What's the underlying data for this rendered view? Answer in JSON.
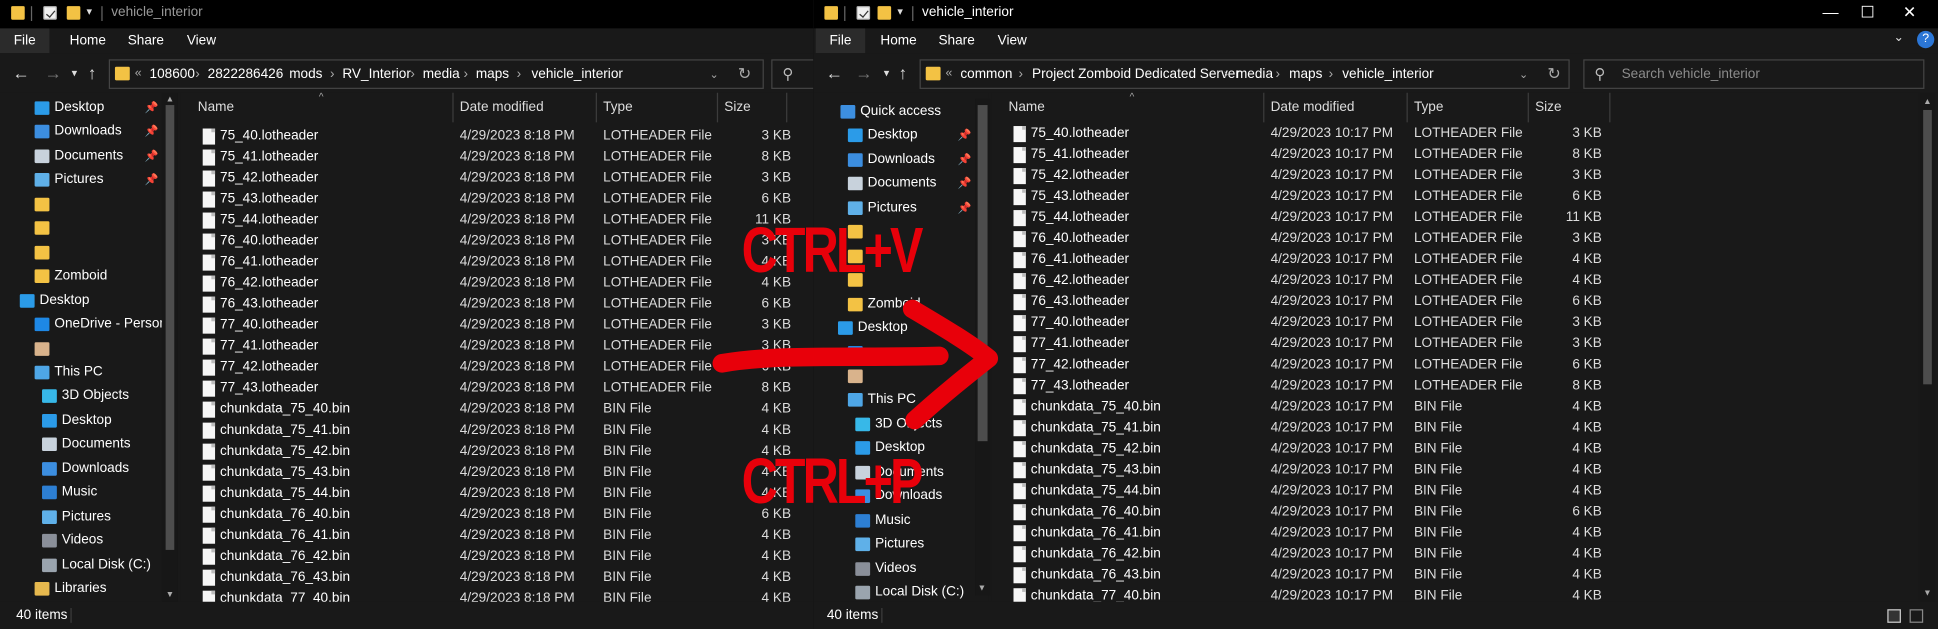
{
  "left_window": {
    "title": "vehicle_interior",
    "ribbon_tabs": [
      "File",
      "Home",
      "Share",
      "View"
    ],
    "address": {
      "overflow": "«",
      "crumbs": [
        "108600",
        "2822286426",
        "mods",
        "RV_Interior",
        "media",
        "maps",
        "vehicle_interior"
      ]
    },
    "nav_items": [
      {
        "label": "Desktop",
        "icon": "desktop-icon",
        "pinned": true
      },
      {
        "label": "Downloads",
        "icon": "downloads-icon",
        "pinned": true
      },
      {
        "label": "Documents",
        "icon": "documents-icon",
        "pinned": true
      },
      {
        "label": "Pictures",
        "icon": "pictures-icon",
        "pinned": true
      },
      {
        "label": "",
        "icon": "folder-icon",
        "pinned": false
      },
      {
        "label": "",
        "icon": "folder-icon",
        "pinned": false
      },
      {
        "label": "",
        "icon": "folder-icon",
        "pinned": false
      },
      {
        "label": "Zomboid",
        "icon": "folder-icon",
        "pinned": false
      },
      {
        "label": "Desktop",
        "icon": "desktop-icon",
        "pinned": false
      },
      {
        "label": "OneDrive - Personal",
        "icon": "cloud-icon",
        "pinned": false
      },
      {
        "label": "",
        "icon": "user-icon",
        "pinned": false
      },
      {
        "label": "This PC",
        "icon": "computer-icon",
        "pinned": false
      },
      {
        "label": "3D Objects",
        "icon": "3d-objects-icon",
        "pinned": false
      },
      {
        "label": "Desktop",
        "icon": "desktop-icon",
        "pinned": false
      },
      {
        "label": "Documents",
        "icon": "documents-icon",
        "pinned": false
      },
      {
        "label": "Downloads",
        "icon": "downloads-icon",
        "pinned": false
      },
      {
        "label": "Music",
        "icon": "music-icon",
        "pinned": false
      },
      {
        "label": "Pictures",
        "icon": "pictures-icon",
        "pinned": false
      },
      {
        "label": "Videos",
        "icon": "videos-icon",
        "pinned": false
      },
      {
        "label": "Local Disk (C:)",
        "icon": "drive-icon",
        "pinned": false
      },
      {
        "label": "Libraries",
        "icon": "libraries-icon",
        "pinned": false
      }
    ],
    "columns": [
      "Name",
      "Date modified",
      "Type",
      "Size"
    ],
    "files": [
      {
        "name": "75_40.lotheader",
        "date": "4/29/2023 8:18 PM",
        "type": "LOTHEADER File",
        "size": "3 KB"
      },
      {
        "name": "75_41.lotheader",
        "date": "4/29/2023 8:18 PM",
        "type": "LOTHEADER File",
        "size": "8 KB"
      },
      {
        "name": "75_42.lotheader",
        "date": "4/29/2023 8:18 PM",
        "type": "LOTHEADER File",
        "size": "3 KB"
      },
      {
        "name": "75_43.lotheader",
        "date": "4/29/2023 8:18 PM",
        "type": "LOTHEADER File",
        "size": "6 KB"
      },
      {
        "name": "75_44.lotheader",
        "date": "4/29/2023 8:18 PM",
        "type": "LOTHEADER File",
        "size": "11 KB"
      },
      {
        "name": "76_40.lotheader",
        "date": "4/29/2023 8:18 PM",
        "type": "LOTHEADER File",
        "size": "3 KB"
      },
      {
        "name": "76_41.lotheader",
        "date": "4/29/2023 8:18 PM",
        "type": "LOTHEADER File",
        "size": "4 KB"
      },
      {
        "name": "76_42.lotheader",
        "date": "4/29/2023 8:18 PM",
        "type": "LOTHEADER File",
        "size": "4 KB"
      },
      {
        "name": "76_43.lotheader",
        "date": "4/29/2023 8:18 PM",
        "type": "LOTHEADER File",
        "size": "6 KB"
      },
      {
        "name": "77_40.lotheader",
        "date": "4/29/2023 8:18 PM",
        "type": "LOTHEADER File",
        "size": "3 KB"
      },
      {
        "name": "77_41.lotheader",
        "date": "4/29/2023 8:18 PM",
        "type": "LOTHEADER File",
        "size": "3 KB"
      },
      {
        "name": "77_42.lotheader",
        "date": "4/29/2023 8:18 PM",
        "type": "LOTHEADER File",
        "size": "6 KB"
      },
      {
        "name": "77_43.lotheader",
        "date": "4/29/2023 8:18 PM",
        "type": "LOTHEADER File",
        "size": "8 KB"
      },
      {
        "name": "chunkdata_75_40.bin",
        "date": "4/29/2023 8:18 PM",
        "type": "BIN File",
        "size": "4 KB"
      },
      {
        "name": "chunkdata_75_41.bin",
        "date": "4/29/2023 8:18 PM",
        "type": "BIN File",
        "size": "4 KB"
      },
      {
        "name": "chunkdata_75_42.bin",
        "date": "4/29/2023 8:18 PM",
        "type": "BIN File",
        "size": "4 KB"
      },
      {
        "name": "chunkdata_75_43.bin",
        "date": "4/29/2023 8:18 PM",
        "type": "BIN File",
        "size": "4 KB"
      },
      {
        "name": "chunkdata_75_44.bin",
        "date": "4/29/2023 8:18 PM",
        "type": "BIN File",
        "size": "4 KB"
      },
      {
        "name": "chunkdata_76_40.bin",
        "date": "4/29/2023 8:18 PM",
        "type": "BIN File",
        "size": "6 KB"
      },
      {
        "name": "chunkdata_76_41.bin",
        "date": "4/29/2023 8:18 PM",
        "type": "BIN File",
        "size": "4 KB"
      },
      {
        "name": "chunkdata_76_42.bin",
        "date": "4/29/2023 8:18 PM",
        "type": "BIN File",
        "size": "4 KB"
      },
      {
        "name": "chunkdata_76_43.bin",
        "date": "4/29/2023 8:18 PM",
        "type": "BIN File",
        "size": "4 KB"
      },
      {
        "name": "chunkdata_77_40.bin",
        "date": "4/29/2023 8:18 PM",
        "type": "BIN File",
        "size": "4 KB"
      }
    ],
    "status": "40 items"
  },
  "right_window": {
    "title": "vehicle_interior",
    "ribbon_tabs": [
      "File",
      "Home",
      "Share",
      "View"
    ],
    "address": {
      "overflow": "«",
      "crumbs": [
        "common",
        "Project Zomboid Dedicated Server",
        "media",
        "maps",
        "vehicle_interior"
      ]
    },
    "search_placeholder": "Search vehicle_interior",
    "nav_items": [
      {
        "label": "Quick access",
        "icon": "star-icon",
        "pinned": false
      },
      {
        "label": "Desktop",
        "icon": "desktop-icon",
        "pinned": true
      },
      {
        "label": "Downloads",
        "icon": "downloads-icon",
        "pinned": true
      },
      {
        "label": "Documents",
        "icon": "documents-icon",
        "pinned": true
      },
      {
        "label": "Pictures",
        "icon": "pictures-icon",
        "pinned": true
      },
      {
        "label": "",
        "icon": "folder-icon",
        "pinned": false
      },
      {
        "label": "",
        "icon": "folder-icon",
        "pinned": false
      },
      {
        "label": "",
        "icon": "folder-icon",
        "pinned": false
      },
      {
        "label": "Zomboid",
        "icon": "folder-icon",
        "pinned": false
      },
      {
        "label": "Desktop",
        "icon": "desktop-icon",
        "pinned": false
      },
      {
        "label": "",
        "icon": "cloud-icon",
        "pinned": false
      },
      {
        "label": "",
        "icon": "user-icon",
        "pinned": false
      },
      {
        "label": "This PC",
        "icon": "computer-icon",
        "pinned": false
      },
      {
        "label": "3D Objects",
        "icon": "3d-objects-icon",
        "pinned": false
      },
      {
        "label": "Desktop",
        "icon": "desktop-icon",
        "pinned": false
      },
      {
        "label": "Documents",
        "icon": "documents-icon",
        "pinned": false
      },
      {
        "label": "Downloads",
        "icon": "downloads-icon",
        "pinned": false
      },
      {
        "label": "Music",
        "icon": "music-icon",
        "pinned": false
      },
      {
        "label": "Pictures",
        "icon": "pictures-icon",
        "pinned": false
      },
      {
        "label": "Videos",
        "icon": "videos-icon",
        "pinned": false
      },
      {
        "label": "Local Disk (C:)",
        "icon": "drive-icon",
        "pinned": false
      }
    ],
    "columns": [
      "Name",
      "Date modified",
      "Type",
      "Size"
    ],
    "files": [
      {
        "name": "75_40.lotheader",
        "date": "4/29/2023 10:17 PM",
        "type": "LOTHEADER File",
        "size": "3 KB"
      },
      {
        "name": "75_41.lotheader",
        "date": "4/29/2023 10:17 PM",
        "type": "LOTHEADER File",
        "size": "8 KB"
      },
      {
        "name": "75_42.lotheader",
        "date": "4/29/2023 10:17 PM",
        "type": "LOTHEADER File",
        "size": "3 KB"
      },
      {
        "name": "75_43.lotheader",
        "date": "4/29/2023 10:17 PM",
        "type": "LOTHEADER File",
        "size": "6 KB"
      },
      {
        "name": "75_44.lotheader",
        "date": "4/29/2023 10:17 PM",
        "type": "LOTHEADER File",
        "size": "11 KB"
      },
      {
        "name": "76_40.lotheader",
        "date": "4/29/2023 10:17 PM",
        "type": "LOTHEADER File",
        "size": "3 KB"
      },
      {
        "name": "76_41.lotheader",
        "date": "4/29/2023 10:17 PM",
        "type": "LOTHEADER File",
        "size": "4 KB"
      },
      {
        "name": "76_42.lotheader",
        "date": "4/29/2023 10:17 PM",
        "type": "LOTHEADER File",
        "size": "4 KB"
      },
      {
        "name": "76_43.lotheader",
        "date": "4/29/2023 10:17 PM",
        "type": "LOTHEADER File",
        "size": "6 KB"
      },
      {
        "name": "77_40.lotheader",
        "date": "4/29/2023 10:17 PM",
        "type": "LOTHEADER File",
        "size": "3 KB"
      },
      {
        "name": "77_41.lotheader",
        "date": "4/29/2023 10:17 PM",
        "type": "LOTHEADER File",
        "size": "3 KB"
      },
      {
        "name": "77_42.lotheader",
        "date": "4/29/2023 10:17 PM",
        "type": "LOTHEADER File",
        "size": "6 KB"
      },
      {
        "name": "77_43.lotheader",
        "date": "4/29/2023 10:17 PM",
        "type": "LOTHEADER File",
        "size": "8 KB"
      },
      {
        "name": "chunkdata_75_40.bin",
        "date": "4/29/2023 10:17 PM",
        "type": "BIN File",
        "size": "4 KB"
      },
      {
        "name": "chunkdata_75_41.bin",
        "date": "4/29/2023 10:17 PM",
        "type": "BIN File",
        "size": "4 KB"
      },
      {
        "name": "chunkdata_75_42.bin",
        "date": "4/29/2023 10:17 PM",
        "type": "BIN File",
        "size": "4 KB"
      },
      {
        "name": "chunkdata_75_43.bin",
        "date": "4/29/2023 10:17 PM",
        "type": "BIN File",
        "size": "4 KB"
      },
      {
        "name": "chunkdata_75_44.bin",
        "date": "4/29/2023 10:17 PM",
        "type": "BIN File",
        "size": "4 KB"
      },
      {
        "name": "chunkdata_76_40.bin",
        "date": "4/29/2023 10:17 PM",
        "type": "BIN File",
        "size": "6 KB"
      },
      {
        "name": "chunkdata_76_41.bin",
        "date": "4/29/2023 10:17 PM",
        "type": "BIN File",
        "size": "4 KB"
      },
      {
        "name": "chunkdata_76_42.bin",
        "date": "4/29/2023 10:17 PM",
        "type": "BIN File",
        "size": "4 KB"
      },
      {
        "name": "chunkdata_76_43.bin",
        "date": "4/29/2023 10:17 PM",
        "type": "BIN File",
        "size": "4 KB"
      },
      {
        "name": "chunkdata_77_40.bin",
        "date": "4/29/2023 10:17 PM",
        "type": "BIN File",
        "size": "4 KB"
      }
    ],
    "status": "40 items"
  },
  "overlay": {
    "top_text": "CTRL+V",
    "bottom_text": "CTRL+P",
    "color": "#e8000a"
  },
  "colors": {
    "window_bg": "#191919",
    "titlebar_bg": "#000000",
    "folder": "#f3c244"
  }
}
